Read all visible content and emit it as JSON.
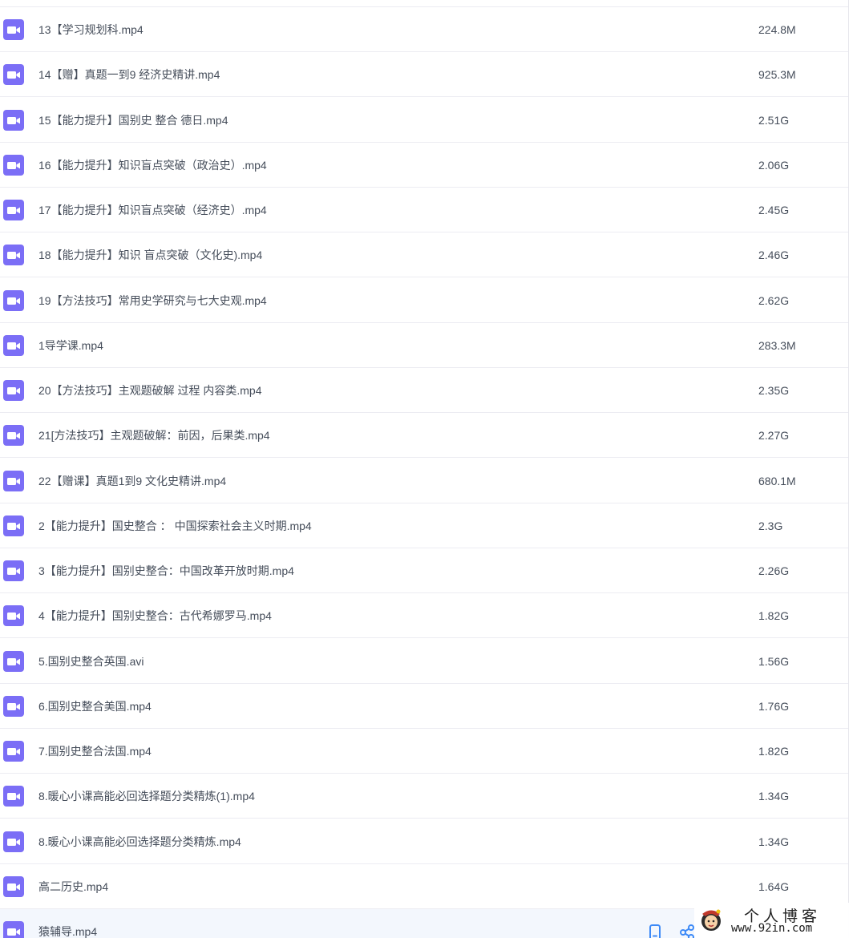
{
  "files": [
    {
      "name": "13【学习规划科.mp4",
      "size": "224.8M"
    },
    {
      "name": "14【赠】真题一到9 经济史精讲.mp4",
      "size": "925.3M"
    },
    {
      "name": "15【能力提升】国别史 整合 德日.mp4",
      "size": "2.51G"
    },
    {
      "name": "16【能力提升】知识盲点突破（政治史）.mp4",
      "size": "2.06G"
    },
    {
      "name": "17【能力提升】知识盲点突破（经济史）.mp4",
      "size": "2.45G"
    },
    {
      "name": "18【能力提升】知识 盲点突破（文化史).mp4",
      "size": "2.46G"
    },
    {
      "name": "19【方法技巧】常用史学研究与七大史观.mp4",
      "size": "2.62G"
    },
    {
      "name": "1导学课.mp4",
      "size": "283.3M"
    },
    {
      "name": "20【方法技巧】主观题破解 过程 内容类.mp4",
      "size": "2.35G"
    },
    {
      "name": "21[方法技巧】主观题破解：前因，后果类.mp4",
      "size": "2.27G"
    },
    {
      "name": "22【赠课】真题1到9 文化史精讲.mp4",
      "size": "680.1M"
    },
    {
      "name": "2【能力提升】国史整合 ： 中国探索社会主义时期.mp4",
      "size": "2.3G"
    },
    {
      "name": "3【能力提升】国别史整合：中国改革开放时期.mp4",
      "size": "2.26G"
    },
    {
      "name": "4【能力提升】国别史整合：古代希娜罗马.mp4",
      "size": "1.82G"
    },
    {
      "name": "5.国别史整合英国.avi",
      "size": "1.56G"
    },
    {
      "name": "6.国别史整合美国.mp4",
      "size": "1.76G"
    },
    {
      "name": "7.国别史整合法国.mp4",
      "size": "1.82G"
    },
    {
      "name": "8.暖心小课高能必回选择题分类精炼(1).mp4",
      "size": "1.34G"
    },
    {
      "name": "8.暖心小课高能必回选择题分类精炼.mp4",
      "size": "1.34G"
    },
    {
      "name": "高二历史.mp4",
      "size": "1.64G"
    },
    {
      "name": "猿辅导.mp4",
      "size": ""
    }
  ],
  "icons": {
    "file": "video-file-icon",
    "phone": "mobile-view-icon",
    "share": "share-icon"
  },
  "watermark": {
    "title": "个人博客",
    "url": "www.92in.com"
  },
  "colors": {
    "icon_purple": "#7b6ef6",
    "text": "#454d5a",
    "action_blue": "#3d8af7",
    "highlight_row": "#f3f7fd"
  }
}
